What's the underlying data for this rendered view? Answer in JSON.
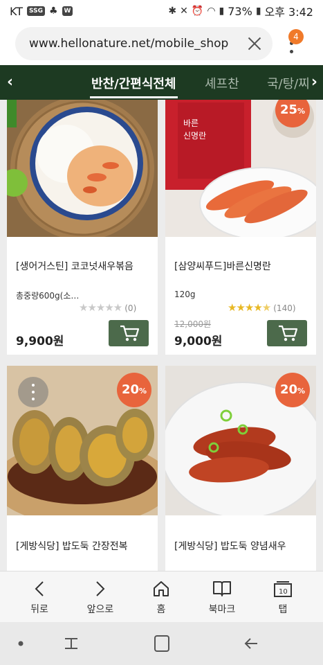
{
  "status_bar": {
    "carrier": "KT",
    "badges": [
      "SSG",
      "W"
    ],
    "battery": "73%",
    "time": "오후 3:42"
  },
  "browser": {
    "url": "www.hellonature.net/mobile_shop",
    "tab_count": "4"
  },
  "category_nav": {
    "tabs": [
      {
        "label": "반찬/간편식전체",
        "active": true
      },
      {
        "label": "셰프찬",
        "active": false
      },
      {
        "label": "국/탕/찌",
        "active": false
      }
    ]
  },
  "products": [
    {
      "name": "[생어거스틴] 코코넛새우볶음",
      "weight": "총중량600g(소…",
      "rating": 0,
      "review_count": "(0)",
      "price": "9,900원",
      "discount": "",
      "original_price": ""
    },
    {
      "name": "[삼양씨푸드]바른신명란",
      "weight": "120g",
      "rating": 4.5,
      "review_count": "(140)",
      "price": "9,000원",
      "discount": "25",
      "original_price": "12,000원"
    },
    {
      "name": "[게방식당] 밥도둑 간장전복",
      "discount": "20"
    },
    {
      "name": "[게방식당] 밥도둑 양념새우",
      "discount": "20"
    }
  ],
  "package_label": "바른\n신명란",
  "bottom_nav": [
    {
      "label": "뒤로",
      "icon": "back-icon"
    },
    {
      "label": "앞으로",
      "icon": "forward-icon"
    },
    {
      "label": "홈",
      "icon": "home-icon"
    },
    {
      "label": "북마크",
      "icon": "bookmark-icon"
    },
    {
      "label": "탭",
      "icon": "tabs-icon",
      "count": "10"
    }
  ],
  "colors": {
    "nav_bg": "#1d3a22",
    "discount": "#e8643c",
    "cart_button": "#4c6a4b",
    "star": "#e8b824",
    "tab_badge": "#f07a2a"
  }
}
